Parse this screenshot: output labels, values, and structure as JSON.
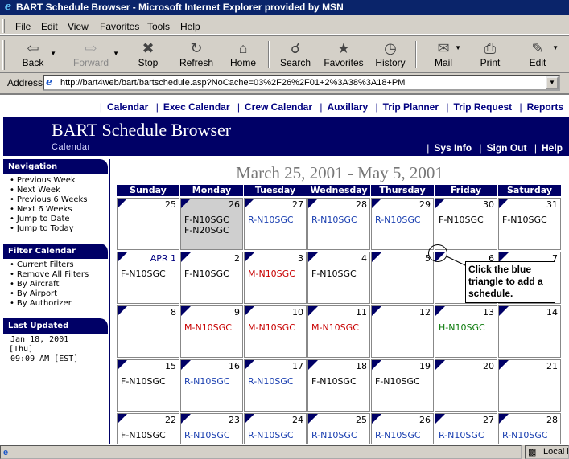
{
  "window": {
    "title": "BART Schedule Browser - Microsoft Internet Explorer provided by MSN"
  },
  "menu": [
    "File",
    "Edit",
    "View",
    "Favorites",
    "Tools",
    "Help"
  ],
  "toolbar": {
    "back": "Back",
    "forward": "Forward",
    "stop": "Stop",
    "refresh": "Refresh",
    "home": "Home",
    "search": "Search",
    "favorites": "Favorites",
    "history": "History",
    "mail": "Mail",
    "print": "Print",
    "edit": "Edit"
  },
  "address": {
    "label": "Address",
    "url": "http://bart4web/bart/bartschedule.asp?NoCache=03%2F26%2F01+2%3A38%3A18+PM"
  },
  "top_links": [
    "Calendar",
    "Exec Calendar",
    "Crew Calendar",
    "Auxillary",
    "Trip Planner",
    "Trip Request",
    "Reports"
  ],
  "banner": {
    "title": "BART Schedule Browser",
    "subtitle": "Calendar",
    "links": [
      "Sys Info",
      "Sign Out",
      "Help"
    ]
  },
  "sidebar": {
    "navigation": {
      "heading": "Navigation",
      "items": [
        "Previous Week",
        "Next Week",
        "Previous 6 Weeks",
        "Next 6 Weeks",
        "Jump to Date",
        "Jump to Today"
      ]
    },
    "filter": {
      "heading": "Filter Calendar",
      "items": [
        "Current Filters",
        "Remove All Filters",
        "By Aircraft",
        "By Airport",
        "By Authorizer"
      ]
    },
    "updated": {
      "heading": "Last Updated",
      "date": "Jan 18, 2001",
      "day": "[Thu]",
      "time": "09:09 AM [EST]"
    }
  },
  "calendar": {
    "range": "March 25, 2001 - May 5, 2001",
    "days": [
      "Sunday",
      "Monday",
      "Tuesday",
      "Wednesday",
      "Thursday",
      "Friday",
      "Saturday"
    ],
    "weeks": [
      [
        {
          "day": "25",
          "events": []
        },
        {
          "day": "26",
          "today": true,
          "events": [
            {
              "text": "F-N10SGC",
              "type": "F"
            },
            {
              "text": "F-N20SGC",
              "type": "F"
            }
          ]
        },
        {
          "day": "27",
          "events": [
            {
              "text": "R-N10SGC",
              "type": "R"
            }
          ]
        },
        {
          "day": "28",
          "events": [
            {
              "text": "R-N10SGC",
              "type": "R"
            }
          ]
        },
        {
          "day": "29",
          "events": [
            {
              "text": "R-N10SGC",
              "type": "R"
            }
          ]
        },
        {
          "day": "30",
          "events": [
            {
              "text": "F-N10SGC",
              "type": "F"
            }
          ]
        },
        {
          "day": "31",
          "events": [
            {
              "text": "F-N10SGC",
              "type": "F"
            }
          ]
        }
      ],
      [
        {
          "day": "APR 1",
          "month": true,
          "events": [
            {
              "text": "F-N10SGC",
              "type": "F"
            }
          ]
        },
        {
          "day": "2",
          "events": [
            {
              "text": "F-N10SGC",
              "type": "F"
            }
          ]
        },
        {
          "day": "3",
          "events": [
            {
              "text": "M-N10SGC",
              "type": "M"
            }
          ]
        },
        {
          "day": "4",
          "events": [
            {
              "text": "F-N10SGC",
              "type": "F"
            }
          ]
        },
        {
          "day": "5",
          "events": []
        },
        {
          "day": "6",
          "events": []
        },
        {
          "day": "7",
          "events": []
        }
      ],
      [
        {
          "day": "8",
          "events": []
        },
        {
          "day": "9",
          "events": [
            {
              "text": "M-N10SGC",
              "type": "M"
            }
          ]
        },
        {
          "day": "10",
          "events": [
            {
              "text": "M-N10SGC",
              "type": "M"
            }
          ]
        },
        {
          "day": "11",
          "events": [
            {
              "text": "M-N10SGC",
              "type": "M"
            }
          ]
        },
        {
          "day": "12",
          "events": []
        },
        {
          "day": "13",
          "events": [
            {
              "text": "H-N10SGC",
              "type": "H"
            }
          ]
        },
        {
          "day": "14",
          "events": []
        }
      ],
      [
        {
          "day": "15",
          "events": [
            {
              "text": "F-N10SGC",
              "type": "F"
            }
          ]
        },
        {
          "day": "16",
          "events": [
            {
              "text": "R-N10SGC",
              "type": "R"
            }
          ]
        },
        {
          "day": "17",
          "events": [
            {
              "text": "R-N10SGC",
              "type": "R"
            }
          ]
        },
        {
          "day": "18",
          "events": [
            {
              "text": "F-N10SGC",
              "type": "F"
            }
          ]
        },
        {
          "day": "19",
          "events": [
            {
              "text": "F-N10SGC",
              "type": "F"
            }
          ]
        },
        {
          "day": "20",
          "events": []
        },
        {
          "day": "21",
          "events": []
        }
      ],
      [
        {
          "day": "22",
          "events": [
            {
              "text": "F-N10SGC",
              "type": "F"
            }
          ]
        },
        {
          "day": "23",
          "events": [
            {
              "text": "R-N10SGC",
              "type": "R"
            }
          ]
        },
        {
          "day": "24",
          "events": [
            {
              "text": "R-N10SGC",
              "type": "R"
            }
          ]
        },
        {
          "day": "25",
          "events": [
            {
              "text": "R-N10SGC",
              "type": "R"
            }
          ]
        },
        {
          "day": "26",
          "events": [
            {
              "text": "R-N10SGC",
              "type": "R"
            }
          ]
        },
        {
          "day": "27",
          "events": [
            {
              "text": "R-N10SGC",
              "type": "R"
            }
          ]
        },
        {
          "day": "28",
          "events": [
            {
              "text": "R-N10SGC",
              "type": "R"
            }
          ]
        }
      ]
    ]
  },
  "callout": "Click the blue triangle to add a schedule.",
  "status": {
    "main": "",
    "zone": "Local i"
  },
  "colors": {
    "banner": "#000066",
    "title_bar": "#0a246a",
    "event_F": "#000000",
    "event_R": "#1a3fb0",
    "event_M": "#c80000",
    "event_H": "#0a7a0a",
    "today_cell": "#cfcfcf"
  }
}
